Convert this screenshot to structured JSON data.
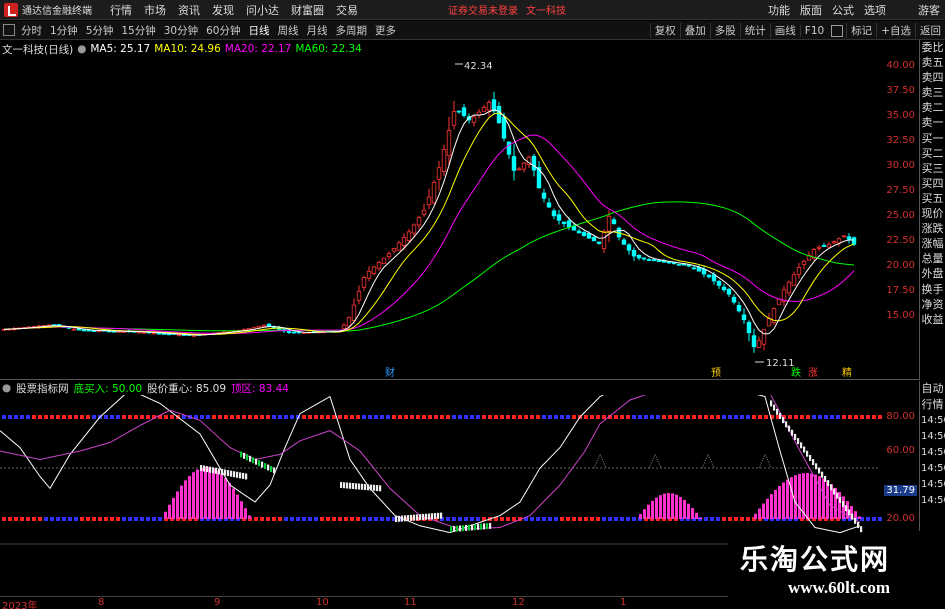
{
  "menubar": {
    "app_title": "通达信金融终端",
    "items": [
      "行情",
      "市场",
      "资讯",
      "发现",
      "问小达",
      "财富圈",
      "交易"
    ],
    "notice": "证券交易未登录",
    "notice_stock": "文一科技",
    "right_items": [
      "功能",
      "版面",
      "公式",
      "选项",
      "游客"
    ]
  },
  "toolbar": {
    "periods": [
      "分时",
      "1分钟",
      "5分钟",
      "15分钟",
      "30分钟",
      "60分钟",
      "日线",
      "周线",
      "月线",
      "多周期",
      "更多"
    ],
    "active_period": "日线",
    "right_buttons": [
      "复权",
      "叠加",
      "多股",
      "统计",
      "画线",
      "F10",
      "标记",
      "+自选",
      "返回"
    ]
  },
  "main_chart": {
    "stock_title": "文一科技(日线)",
    "ma5_label": "MA5: 25.17",
    "ma10_label": "MA10: 24.96",
    "ma20_label": "MA20: 22.17",
    "ma60_label": "MA60: 22.34",
    "high_label": "42.34",
    "low_label": "12.11",
    "markers": [
      "财",
      "预",
      "跌",
      "涨",
      "精"
    ],
    "price_ticks": [
      "40.00",
      "37.50",
      "35.00",
      "32.50",
      "30.00",
      "27.50",
      "25.00",
      "22.50",
      "20.00",
      "17.50",
      "15.00"
    ],
    "colors": {
      "up": "#ff3333",
      "down": "#00ffff",
      "ma5": "#ffffff",
      "ma10": "#ffff00",
      "ma20": "#ff00ff",
      "ma60": "#00ff00"
    }
  },
  "right_panel": {
    "items": [
      "委比",
      "卖五",
      "卖四",
      "卖三",
      "卖二",
      "卖一",
      "买一",
      "买二",
      "买三",
      "买四",
      "买五",
      "现价",
      "涨跌",
      "涨幅",
      "总量",
      "外盘",
      "换手",
      "净资",
      "收益"
    ]
  },
  "indicator": {
    "name": "股票指标网",
    "label1": "底买入: 50.00",
    "label2": "股价重心: 85.09",
    "label3": "顶区: 83.44",
    "ticks": [
      "80.00",
      "60.00",
      "20.00"
    ],
    "current_value": "31.79"
  },
  "right_panel2": {
    "tabs": [
      "自动",
      "行情"
    ],
    "times": [
      "14:50",
      "14:50",
      "14:50",
      "14:50",
      "14:50",
      "14:50"
    ]
  },
  "datebar": {
    "labels": [
      "2023年",
      "8",
      "9",
      "10",
      "11",
      "12",
      "1"
    ]
  },
  "watermark": {
    "text_cn": "乐淘公式网",
    "url": "www.60lt.com"
  }
}
